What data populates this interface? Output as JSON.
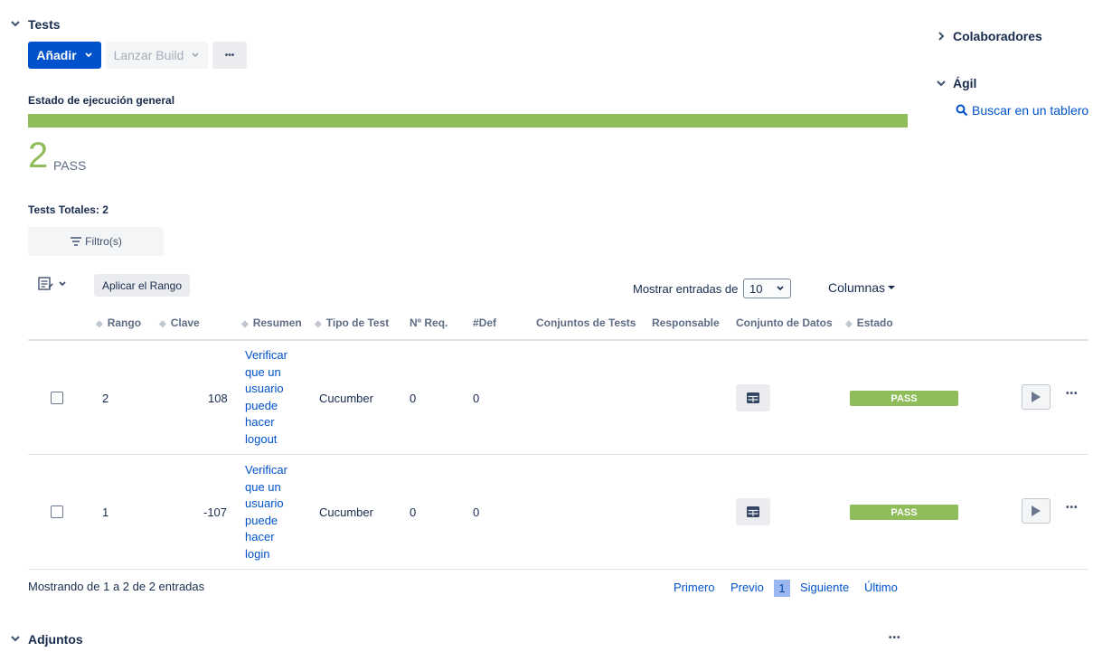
{
  "tests_section": {
    "title": "Tests",
    "add_label": "Añadir",
    "launch_build_label": "Lanzar Build",
    "more_label": "•••"
  },
  "execution": {
    "heading": "Estado de ejecución general",
    "progress_pass_fraction": 1.0,
    "progress_color": "#8fbd5a",
    "count": "2",
    "status_label": "PASS"
  },
  "totals": {
    "label": "Tests Totales: 2",
    "filter_label": "Filtro(s)"
  },
  "table_controls": {
    "apply_range_label": "Aplicar el Rango",
    "show_entries_label": "Mostrar entradas de",
    "show_entries_value": "10",
    "columns_label": "Columnas"
  },
  "columns": {
    "rank": "Rango",
    "key": "Clave",
    "summary": "Resumen",
    "test_type": "Tipo de Test",
    "req_count": "Nº Req.",
    "def_count": "#Def",
    "test_sets": "Conjuntos de Tests",
    "assignee": "Responsable",
    "dataset": "Conjunto de Datos",
    "status": "Estado"
  },
  "rows": [
    {
      "rank": "2",
      "key": "108",
      "summary_lines": [
        "Verificar",
        "que un",
        "usuario",
        "puede",
        "hacer",
        "logout"
      ],
      "test_type": "Cucumber",
      "req": "0",
      "def": "0",
      "status": "PASS"
    },
    {
      "rank": "1",
      "key": "-107",
      "summary_lines": [
        "Verificar",
        "que un",
        "usuario",
        "puede",
        "hacer",
        "login"
      ],
      "test_type": "Cucumber",
      "req": "0",
      "def": "0",
      "status": "PASS"
    }
  ],
  "footer": {
    "showing": "Mostrando de 1 a 2 de 2 entradas",
    "first": "Primero",
    "prev": "Previo",
    "page": "1",
    "next": "Siguiente",
    "last": "Último"
  },
  "attachments": {
    "title": "Adjuntos",
    "more": "•••"
  },
  "sidebar": {
    "collaborators": "Colaboradores",
    "agile": "Ágil",
    "search_board": "Buscar en un tablero"
  }
}
